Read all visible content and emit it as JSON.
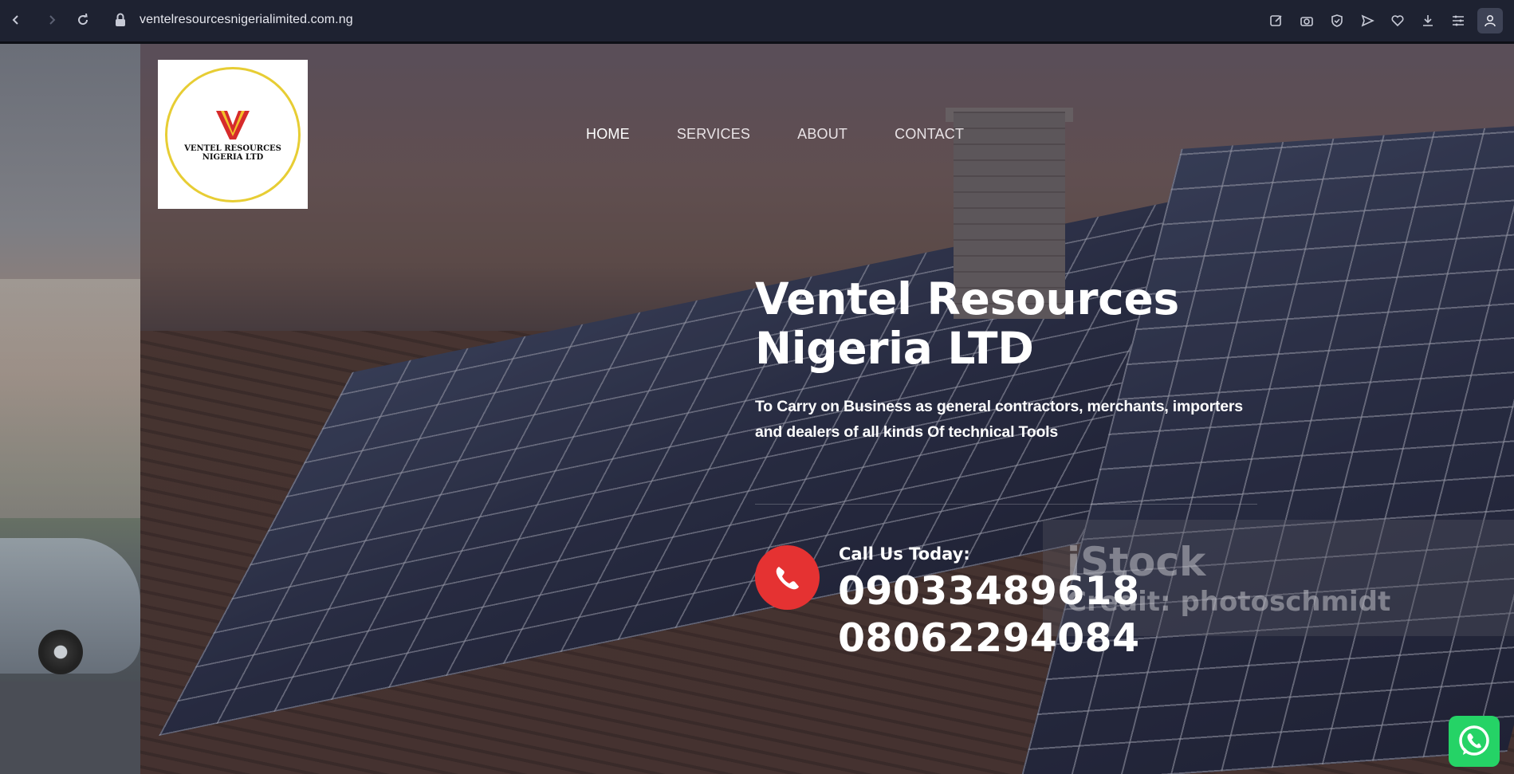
{
  "browser": {
    "url": "ventelresourcesnigerialimited.com.ng"
  },
  "site": {
    "logo_text": "VENTEL RESOURCES NIGERIA LTD",
    "logo_letter": "V",
    "nav": [
      {
        "label": "HOME"
      },
      {
        "label": "SERVICES"
      },
      {
        "label": "ABOUT"
      },
      {
        "label": "CONTACT"
      }
    ],
    "hero": {
      "title": "Ventel Resources Nigeria LTD",
      "description": "To Carry on Business as general  contractors, merchants, importers and dealers of all kinds Of technical Tools",
      "call_label": "Call Us Today:",
      "phone_1": "09033489618",
      "phone_2": "08062294084"
    },
    "watermark": {
      "brand": "iStock",
      "credit": "Credit: photoschmidt"
    }
  },
  "colors": {
    "accent_red": "#e53232",
    "whatsapp_green": "#25d366",
    "logo_gold": "#e7cd34"
  }
}
